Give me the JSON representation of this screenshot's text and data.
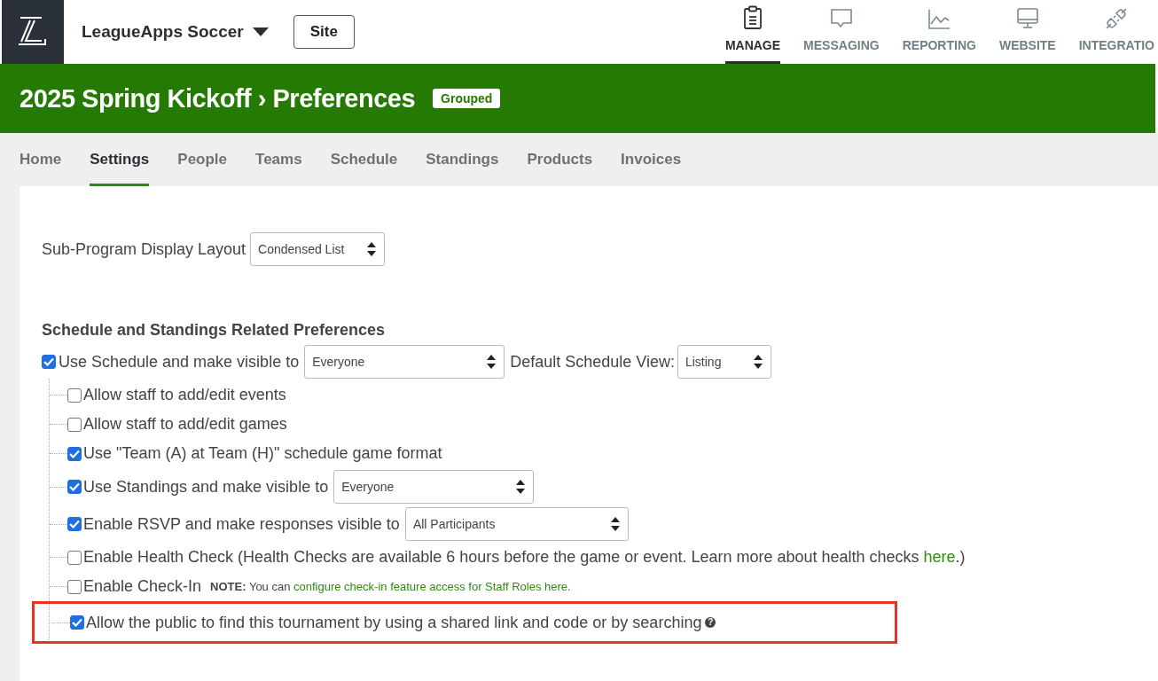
{
  "top_bar": {
    "org_name": "LeagueApps Soccer",
    "site_button": "Site",
    "nav": [
      {
        "label": "MANAGE",
        "selected": true
      },
      {
        "label": "MESSAGING",
        "selected": false
      },
      {
        "label": "REPORTING",
        "selected": false
      },
      {
        "label": "WEBSITE",
        "selected": false
      },
      {
        "label": "INTEGRATIO",
        "selected": false
      }
    ]
  },
  "banner": {
    "title": "2025 Spring Kickoff › Preferences",
    "badge": "Grouped"
  },
  "tabs": [
    {
      "label": "Home",
      "selected": false
    },
    {
      "label": "Settings",
      "selected": true
    },
    {
      "label": "People",
      "selected": false
    },
    {
      "label": "Teams",
      "selected": false
    },
    {
      "label": "Schedule",
      "selected": false
    },
    {
      "label": "Standings",
      "selected": false
    },
    {
      "label": "Products",
      "selected": false
    },
    {
      "label": "Invoices",
      "selected": false
    }
  ],
  "display_layout": {
    "label": "Sub-Program Display Layout",
    "value": "Condensed List"
  },
  "section_heading": "Schedule and Standings Related Preferences",
  "schedule": {
    "checked": true,
    "label": "Use Schedule and make visible to",
    "value": "Everyone",
    "view_label": "Default Schedule View:",
    "view_value": "Listing",
    "children": [
      {
        "kind": "plain",
        "checked": false,
        "highlighted": false,
        "label": "Allow staff to add/edit events"
      },
      {
        "kind": "plain",
        "checked": false,
        "highlighted": false,
        "label": "Allow staff to add/edit games"
      },
      {
        "kind": "plain",
        "checked": true,
        "highlighted": false,
        "label": "Use \"Team (A) at Team (H)\" schedule game format"
      },
      {
        "kind": "select",
        "checked": true,
        "highlighted": false,
        "label": "Use Standings and make visible to",
        "value": "Everyone"
      },
      {
        "kind": "select",
        "checked": true,
        "highlighted": false,
        "label": "Enable RSVP and make responses visible to",
        "value": "All Participants"
      },
      {
        "kind": "link",
        "checked": false,
        "highlighted": false,
        "label": "Enable Health Check (Health Checks are available 6 hours before the game or event. Learn more about health checks ",
        "link": "here",
        "after": ".)"
      },
      {
        "kind": "note",
        "checked": false,
        "highlighted": false,
        "label": "Enable Check-In",
        "note": "**NOTE:** You can ",
        "link": "configure check-in feature access for Staff Roles here."
      },
      {
        "kind": "help",
        "checked": true,
        "highlighted": true,
        "label": "Allow the public to find this tournament by using a shared link and code or by searching",
        "help_icon": "?"
      }
    ]
  }
}
